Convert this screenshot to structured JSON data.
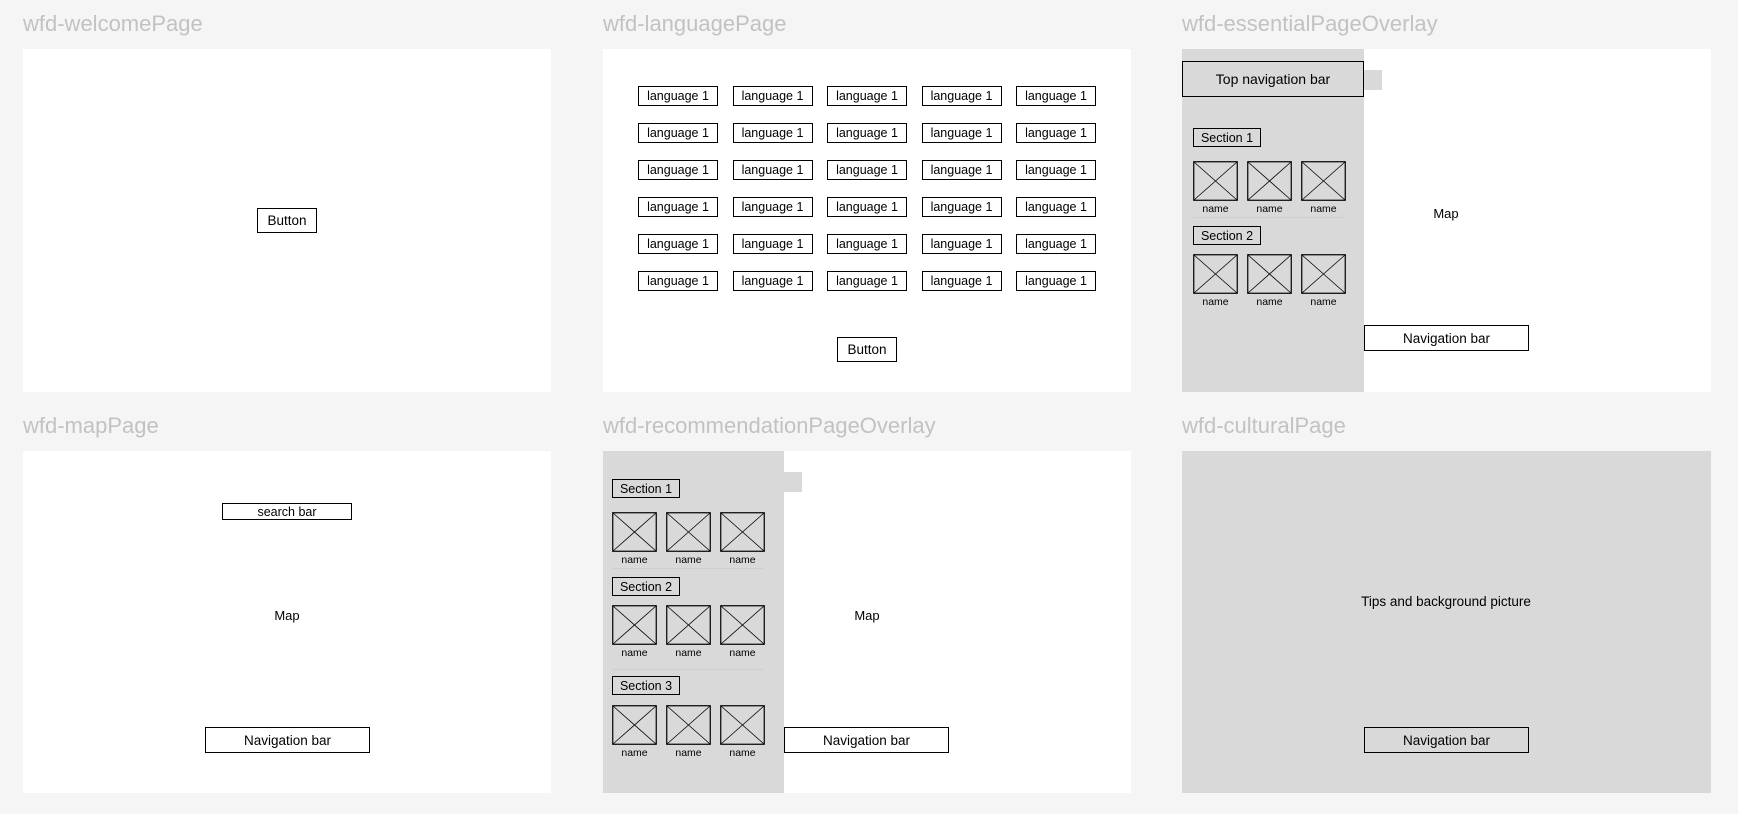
{
  "frames": {
    "welcome": {
      "label": "wfd-welcomePage",
      "button_label": "Button"
    },
    "language": {
      "label": "wfd-languagePage",
      "language_option_label": "language 1",
      "button_label": "Button"
    },
    "essential": {
      "label": "wfd-essentialPageOverlay",
      "top_nav_label": "Top navigation bar",
      "sections": [
        {
          "title": "Section 1",
          "items": [
            "name",
            "name",
            "name"
          ]
        },
        {
          "title": "Section 2",
          "items": [
            "name",
            "name",
            "name"
          ]
        }
      ],
      "map_label": "Map",
      "nav_label": "Navigation bar"
    },
    "map": {
      "label": "wfd-mapPage",
      "search_label": "search bar",
      "map_label": "Map",
      "nav_label": "Navigation bar"
    },
    "recommendation": {
      "label": "wfd-recommendationPageOverlay",
      "sections": [
        {
          "title": "Section 1",
          "items": [
            "name",
            "name",
            "name"
          ]
        },
        {
          "title": "Section 2",
          "items": [
            "name",
            "name",
            "name"
          ]
        },
        {
          "title": "Section 3",
          "items": [
            "name",
            "name",
            "name"
          ]
        }
      ],
      "map_label": "Map",
      "nav_label": "Navigation bar"
    },
    "cultural": {
      "label": "wfd-culturalPage",
      "tips_label": "Tips and background picture",
      "nav_label": "Navigation bar"
    }
  },
  "colors": {
    "canvas": "#f5f5f5",
    "frame": "#ffffff",
    "panel": "#d9d9d9",
    "frame_label": "#c2c2c2",
    "stroke": "#000000"
  }
}
